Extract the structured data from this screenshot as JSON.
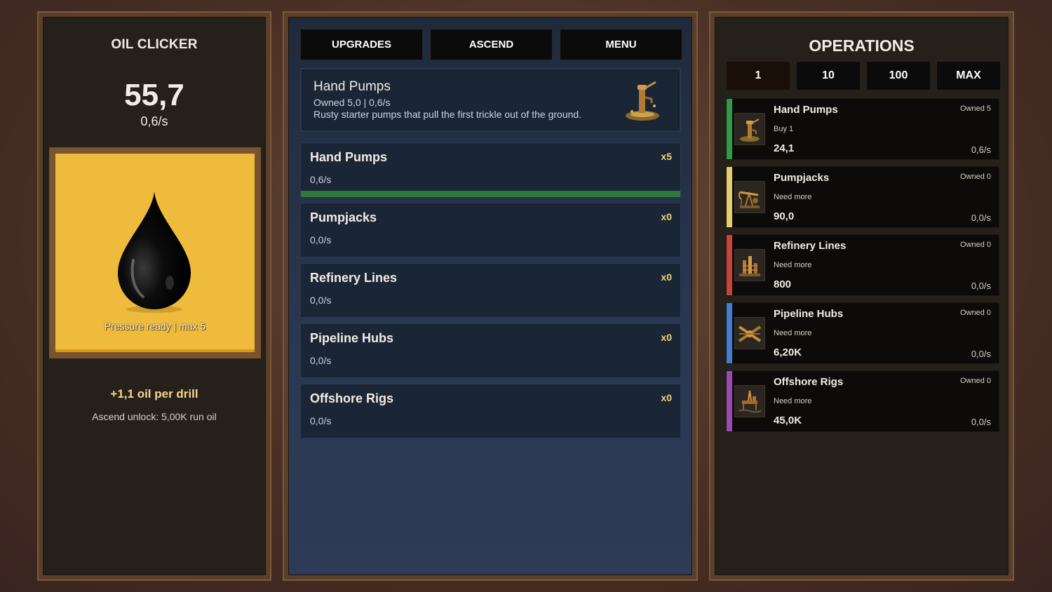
{
  "left": {
    "title": "OIL CLICKER",
    "oil_total": "55,7",
    "oil_rate": "0,6/s",
    "pressure": "Pressure ready  |  max 5",
    "per_drill": "+1,1 oil per drill",
    "ascend_unlock": "Ascend unlock: 5,00K run oil"
  },
  "tabs": [
    "UPGRADES",
    "ASCEND",
    "MENU"
  ],
  "detail": {
    "name": "Hand Pumps",
    "owned": "Owned 5,0  |  0,6/s",
    "desc": "Rusty starter pumps that pull the first trickle out of the ground.",
    "icon": "hand-pump-icon"
  },
  "production": [
    {
      "name": "Hand Pumps",
      "rate": "0,6/s",
      "count": "x5",
      "progress": 1.0
    },
    {
      "name": "Pumpjacks",
      "rate": "0,0/s",
      "count": "x0",
      "progress": 0
    },
    {
      "name": "Refinery Lines",
      "rate": "0,0/s",
      "count": "x0",
      "progress": 0
    },
    {
      "name": "Pipeline Hubs",
      "rate": "0,0/s",
      "count": "x0",
      "progress": 0
    },
    {
      "name": "Offshore Rigs",
      "rate": "0,0/s",
      "count": "x0",
      "progress": 0
    }
  ],
  "operations": {
    "title": "OPERATIONS",
    "quantities": [
      "1",
      "10",
      "100",
      "MAX"
    ],
    "selected_quantity": "1",
    "items": [
      {
        "name": "Hand Pumps",
        "owned": "Owned 5",
        "sub": "Buy 1",
        "cost": "24,1",
        "rate": "0,6/s",
        "color": "#2f9b47",
        "icon": "hand-pump-icon"
      },
      {
        "name": "Pumpjacks",
        "owned": "Owned 0",
        "sub": "Need more",
        "cost": "90,0",
        "rate": "0,0/s",
        "color": "#e3cf6b",
        "icon": "pumpjack-icon"
      },
      {
        "name": "Refinery Lines",
        "owned": "Owned 0",
        "sub": "Need more",
        "cost": "800",
        "rate": "0,0/s",
        "color": "#c9433a",
        "icon": "refinery-icon"
      },
      {
        "name": "Pipeline Hubs",
        "owned": "Owned 0",
        "sub": "Need more",
        "cost": "6,20K",
        "rate": "0,0/s",
        "color": "#3e7fd1",
        "icon": "pipeline-icon"
      },
      {
        "name": "Offshore Rigs",
        "owned": "Owned 0",
        "sub": "Need more",
        "cost": "45,0K",
        "rate": "0,0/s",
        "color": "#9c48b5",
        "icon": "offshore-rig-icon"
      }
    ]
  }
}
